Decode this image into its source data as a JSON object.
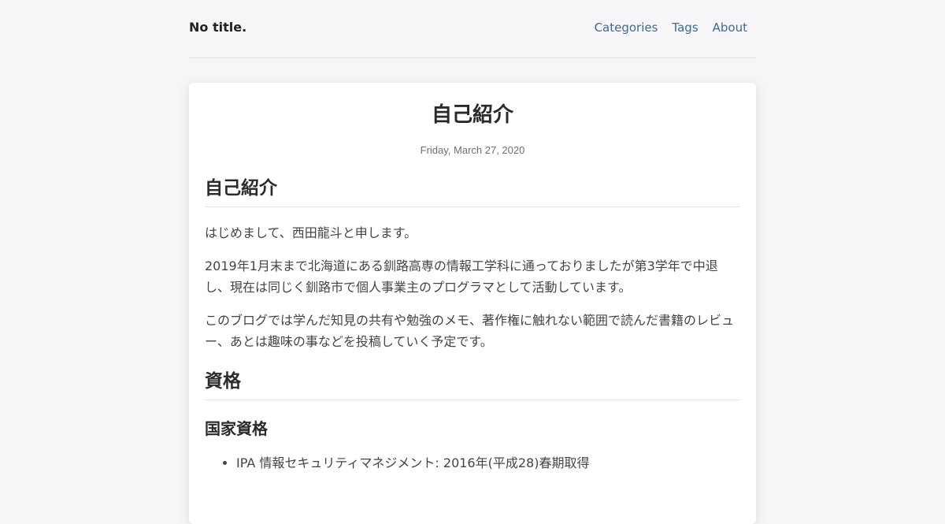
{
  "header": {
    "site_title": "No title.",
    "nav": {
      "categories": "Categories",
      "tags": "Tags",
      "about": "About"
    }
  },
  "post": {
    "title": "自己紹介",
    "date": "Friday, March 27, 2020",
    "sections": {
      "intro_heading": "自己紹介",
      "intro_p1": "はじめまして、西田龍斗と申します。",
      "intro_p2": "2019年1月末まで北海道にある釧路高専の情報工学科に通っておりましたが第3学年で中退し、現在は同じく釧路市で個人事業主のプログラマとして活動しています。",
      "intro_p3": "このブログでは学んだ知見の共有や勉強のメモ、著作権に触れない範囲で読んだ書籍のレビュー、あとは趣味の事などを投稿していく予定です。",
      "qual_heading": "資格",
      "national_heading": "国家資格",
      "national_items": [
        "IPA 情報セキュリティマネジメント: 2016年(平成28)春期取得"
      ]
    }
  },
  "colors": {
    "background": "#f6f6f9",
    "card": "#ffffff",
    "link": "#3e6b96"
  }
}
